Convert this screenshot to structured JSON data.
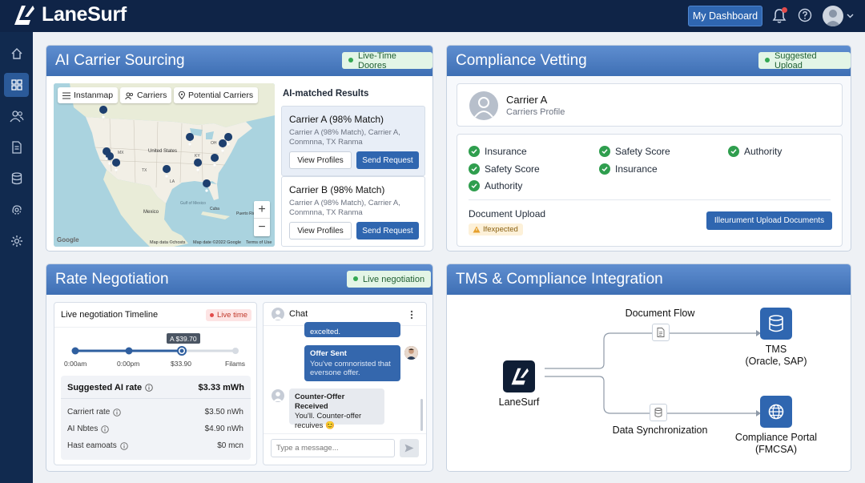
{
  "app": {
    "name": "LaneSurf"
  },
  "topbar": {
    "dashboard_label": "My Dashboard",
    "icons": [
      "bell-icon",
      "help-icon",
      "user-avatar",
      "chevron-down-icon"
    ]
  },
  "sidebar": {
    "items": [
      "home-icon",
      "dashboard-grid-icon",
      "users-icon",
      "document-icon",
      "database-icon",
      "integration-icon",
      "gear-icon"
    ],
    "active_index": 1
  },
  "sourcing": {
    "title": "AI Carrier Sourcing",
    "badge": "Live-Time Doores",
    "map": {
      "chips": [
        "Instanmap",
        "Carriers",
        "Potential Carriers"
      ],
      "labels": {
        "states": "United States",
        "gulf": "Gulf of Mexico",
        "mexico": "Mexico",
        "cuba": "Cuba",
        "puerto": "Puerto Rico",
        "mx": "MX",
        "la": "LA",
        "tx": "TX",
        "ky": "KY",
        "oh": "OH"
      },
      "google": "Google",
      "footer": [
        "Map data ©chosts",
        "Map date ©2022 Google",
        "Terms of Use"
      ],
      "zoom_in": "+",
      "zoom_out": "−"
    },
    "results_title": "AI-matched Results",
    "results": [
      {
        "title": "Carrier A (98% Match)",
        "desc": "Carrier A (98% Match), Carrier A, Conmnna, TX Ranma",
        "view": "View Profiles",
        "send": "Send Request"
      },
      {
        "title": "Carrier B (98% Match)",
        "desc": "Carrier A (98% Match), Carrier A, Conmnna, TX Ranma",
        "view": "View Profiles",
        "send": "Send Request"
      }
    ]
  },
  "compliance": {
    "title": "Compliance Vetting",
    "badge": "Suggested Upload",
    "carrier_name": "Carrier A",
    "carrier_sub": "Carriers Profile",
    "checks": [
      "Insurance",
      "Safety Score",
      "Authority",
      "Safety Score",
      "Insurance",
      "Authority"
    ],
    "doc_upload_label": "Document Upload",
    "doc_status": "Ifexpected",
    "upload_button": "Illeurument Upload Documents"
  },
  "rate": {
    "title": "Rate Negotiation",
    "badge": "Live negotiation",
    "timeline_title": "Live negotiation Timeline",
    "live_badge": "Live time",
    "tooltip": "A $39.70",
    "timeline_labels": [
      "0:00am",
      "0:00pm",
      "$33.90",
      "Filams"
    ],
    "suggested_label": "Suggested AI rate",
    "suggested_value": "$3.33 mWh",
    "rows": [
      {
        "label": "Carriert rate",
        "value": "$3.50 nWh"
      },
      {
        "label": "AI Nbtes",
        "value": "$4.90 nWh"
      },
      {
        "label": "Hast eamoats",
        "value": "$0 mcn"
      }
    ],
    "chat_title": "Chat",
    "chat_partial": "excelted.",
    "offer_title": "Offer Sent",
    "offer_text": "You've comnoristed that eversone offer.",
    "counter_title": "Counter-Offer Received",
    "counter_text": "You'll. Counter-offer recuives 😊",
    "chat_placeholder": "Type a message..."
  },
  "tms": {
    "title": "TMS & Compliance Integration",
    "center_label": "LaneSurf",
    "flow_top": "Document Flow",
    "flow_bottom": "Data Synchronization",
    "target_top": "TMS",
    "target_top_sub": "(Oracle, SAP)",
    "target_bottom": "Compliance Portal",
    "target_bottom_sub": "(FMCSA)"
  },
  "colors": {
    "navy": "#0f2447",
    "accent": "#2f66b0",
    "green": "#2f9e4e",
    "header": "#4a7cc0"
  }
}
